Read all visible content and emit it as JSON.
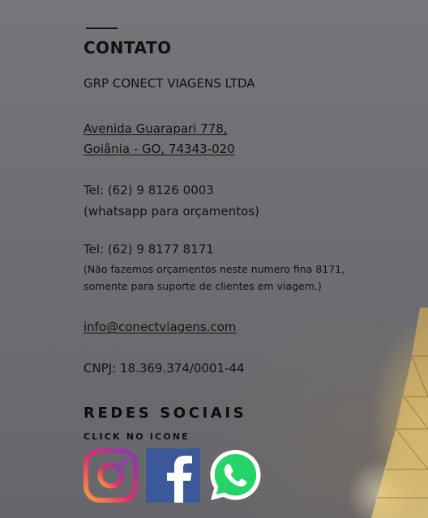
{
  "section": {
    "title": "CONTATO",
    "company": "GRP CONECT VIAGENS LTDA",
    "address_line1": "Avenida Guarapari 778,",
    "address_line2": "Goiânia - GO, 74343-020",
    "phone1": "Tel: (62) 9 8126 0003",
    "phone1_note": "(whatsapp para orçamentos)",
    "phone2": "Tel: (62) 9 8177 8171",
    "phone2_note": "(Não fazemos orçamentos neste numero fina 8171, somente para suporte de clientes em viagem.)",
    "email": "info@conectviagens.com",
    "cnpj": "CNPJ: 18.369.374/0001-44"
  },
  "social": {
    "title": "REDES SOCIAIS",
    "subtitle": "CLICK NO ICONE",
    "icons": [
      "instagram-icon",
      "facebook-icon",
      "whatsapp-icon"
    ]
  },
  "colors": {
    "text": "#111111",
    "facebook": "#3b5998",
    "whatsapp": "#25d366"
  }
}
